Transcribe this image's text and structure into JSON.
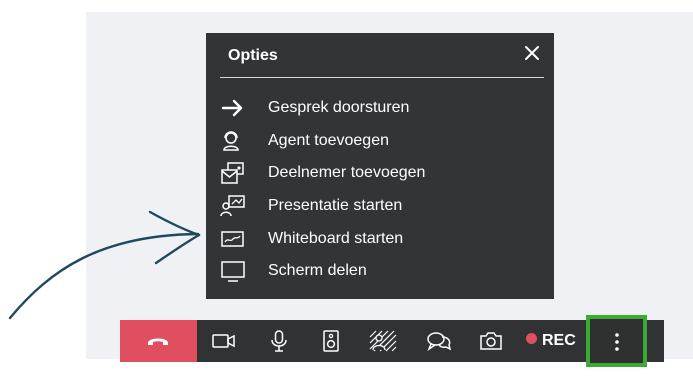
{
  "options_panel": {
    "title": "Opties",
    "items": [
      {
        "icon": "arrow-right-icon",
        "label": "Gesprek doorsturen"
      },
      {
        "icon": "agent-icon",
        "label": "Agent toevoegen"
      },
      {
        "icon": "add-participant-icon",
        "label": "Deelnemer toevoegen"
      },
      {
        "icon": "presentation-icon",
        "label": "Presentatie starten"
      },
      {
        "icon": "whiteboard-icon",
        "label": "Whiteboard starten"
      },
      {
        "icon": "screen-icon",
        "label": "Scherm delen"
      }
    ]
  },
  "toolbar": {
    "buttons": [
      "hang-up-icon",
      "camera-icon",
      "microphone-icon",
      "speaker-icon",
      "background-blur-icon",
      "chat-icon",
      "snapshot-icon"
    ],
    "rec_label": "REC"
  },
  "colors": {
    "panel_bg": "#333435",
    "toolbar_bg": "#313233",
    "hangup": "#e04f5f",
    "rec_dot": "#e04f5f",
    "highlight": "#3cab35",
    "stage_bg": "#f0f1f5"
  }
}
